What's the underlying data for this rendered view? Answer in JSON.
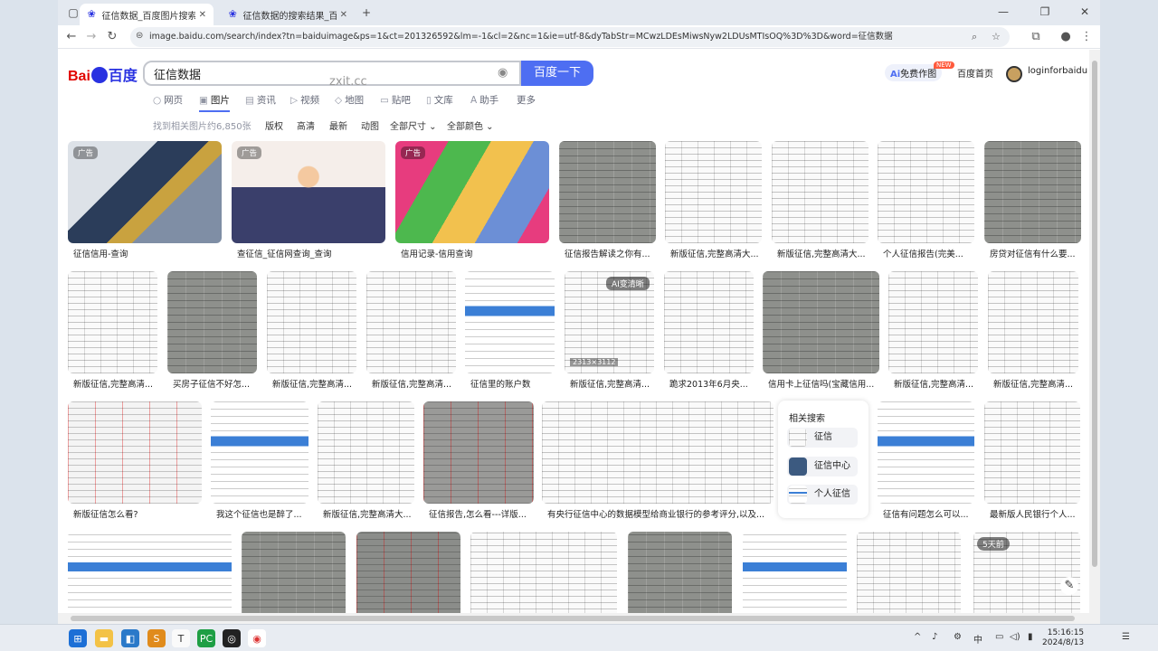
{
  "browser": {
    "tabs": [
      {
        "title": "征信数据_百度图片搜索",
        "icon": "baidu-paw-icon"
      },
      {
        "title": "征信数据的搜索结果_百度图片搜索",
        "icon": "baidu-paw-icon"
      }
    ],
    "url": "image.baidu.com/search/index?tn=baiduimage&ps=1&ct=201326592&lm=-1&cl=2&nc=1&ie=utf-8&dyTabStr=MCwzLDEsMiwsNyw2LDUsMTIsOQ%3D%3D&word=征信数据"
  },
  "header": {
    "logo_text": "Bai",
    "logo_du": "百度",
    "search_value": "征信数据",
    "search_button": "百度一下",
    "watermark": "zxit.cc",
    "ai_draw": "免费作图",
    "new_badge": "NEW",
    "home": "百度首页",
    "username": "loginforbaidu"
  },
  "verticals": [
    {
      "label": "网页",
      "icon": "search-icon"
    },
    {
      "label": "图片",
      "icon": "image-icon"
    },
    {
      "label": "资讯",
      "icon": "news-icon"
    },
    {
      "label": "视频",
      "icon": "video-icon"
    },
    {
      "label": "地图",
      "icon": "map-icon"
    },
    {
      "label": "贴吧",
      "icon": "tieba-icon"
    },
    {
      "label": "文库",
      "icon": "doc-icon"
    },
    {
      "label": "助手",
      "icon": "ai-icon"
    },
    {
      "label": "更多",
      "icon": ""
    }
  ],
  "filters": {
    "count": "找到相关图片约6,850张",
    "items": [
      "版权",
      "高清",
      "最新",
      "动图",
      "全部尺寸",
      "全部颜色"
    ]
  },
  "results": {
    "row1": [
      {
        "cap": "征信信用-查询",
        "ad": "广告"
      },
      {
        "cap": "查征信_征信网查询_查询",
        "ad": "广告"
      },
      {
        "cap": "信用记录-信用查询",
        "ad": "广告"
      },
      {
        "cap": "征信报告解读之你有..."
      },
      {
        "cap": "新版征信,完整高清大..."
      },
      {
        "cap": "新版征信,完整高清大..."
      },
      {
        "cap": "个人征信报告(完美..."
      },
      {
        "cap": "房贷对征信有什么要..."
      }
    ],
    "row2": [
      {
        "cap": "新版征信,完整高清..."
      },
      {
        "cap": "买房子征信不好怎..."
      },
      {
        "cap": "新版征信,完整高清..."
      },
      {
        "cap": "新版征信,完整高清..."
      },
      {
        "cap": "征信里的账户数"
      },
      {
        "cap": "新版征信,完整高清...",
        "badge": "AI变清晰",
        "res": "2313×3112"
      },
      {
        "cap": "跪求2013年6月央..."
      },
      {
        "cap": "信用卡上征信吗(宝藏信用..."
      },
      {
        "cap": "新版征信,完整高清..."
      },
      {
        "cap": "新版征信,完整高清..."
      }
    ],
    "row3": [
      {
        "cap": "新版征信怎么看?"
      },
      {
        "cap": "我这个征信也是醉了..."
      },
      {
        "cap": "新版征信,完整高清大..."
      },
      {
        "cap": "征信报告,怎么看---详版..."
      },
      {
        "cap": "有央行征信中心的数据模型给商业银行的参考评分,以及..."
      },
      {
        "cap": "征信有问题怎么可以..."
      },
      {
        "cap": "最新版人民银行个人..."
      }
    ],
    "row4_video_badge": "5天前"
  },
  "related": {
    "title": "相关搜索",
    "items": [
      {
        "label": "征信"
      },
      {
        "label": "征信中心"
      },
      {
        "label": "个人征信"
      }
    ]
  },
  "taskbar": {
    "time": "15:16:15",
    "date": "2024/8/13"
  }
}
